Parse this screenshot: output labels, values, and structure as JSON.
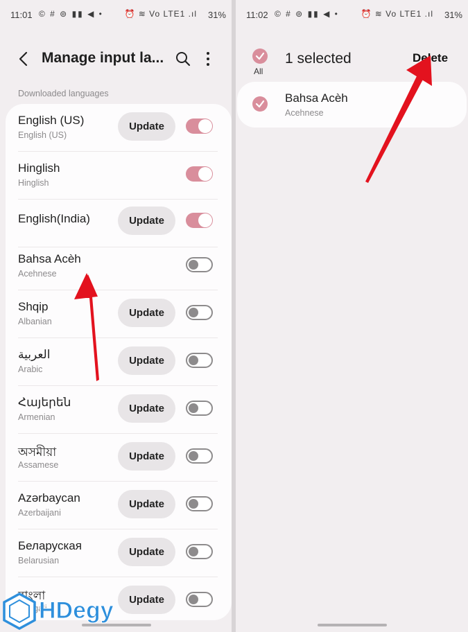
{
  "left": {
    "status": {
      "time": "11:01",
      "notif_icons": "© # ⊚ ▮▮ ◀ •",
      "right_icons": "⏰ ≋ Vo LTE1 .ıl",
      "battery": "31%"
    },
    "header": {
      "title": "Manage input la..."
    },
    "section_label": "Downloaded languages",
    "languages": [
      {
        "name": "English (US)",
        "sub": "English (US)",
        "update": "Update",
        "enabled": true
      },
      {
        "name": "Hinglish",
        "sub": "Hinglish",
        "update": "",
        "enabled": true
      },
      {
        "name": "English(India)",
        "sub": "",
        "update": "Update",
        "enabled": true
      },
      {
        "name": "Bahsa Acèh",
        "sub": "Acehnese",
        "update": "",
        "enabled": false
      },
      {
        "name": "Shqip",
        "sub": "Albanian",
        "update": "Update",
        "enabled": false
      },
      {
        "name": "العربية",
        "sub": "Arabic",
        "update": "Update",
        "enabled": false
      },
      {
        "name": "Հայերեն",
        "sub": "Armenian",
        "update": "Update",
        "enabled": false
      },
      {
        "name": "অসমীয়া",
        "sub": "Assamese",
        "update": "Update",
        "enabled": false
      },
      {
        "name": "Azərbaycan",
        "sub": "Azerbaijani",
        "update": "Update",
        "enabled": false
      },
      {
        "name": "Беларуская",
        "sub": "Belarusian",
        "update": "Update",
        "enabled": false
      },
      {
        "name": "বাংলা",
        "sub": "Bengali",
        "update": "Update",
        "enabled": false
      }
    ]
  },
  "right": {
    "status": {
      "time": "11:02",
      "notif_icons": "© # ⊚ ▮▮ ◀ •",
      "right_icons": "⏰ ≋ Vo LTE1 .ıl",
      "battery": "31%"
    },
    "all_label": "All",
    "selected_count": "1 selected",
    "delete_label": "Delete",
    "selected_item": {
      "name": "Bahsa Acèh",
      "sub": "Acehnese"
    }
  },
  "watermark": "HDegy",
  "colors": {
    "accent": "#d98e9c",
    "arrow": "#e3121e",
    "watermark": "#2e8fdc"
  }
}
